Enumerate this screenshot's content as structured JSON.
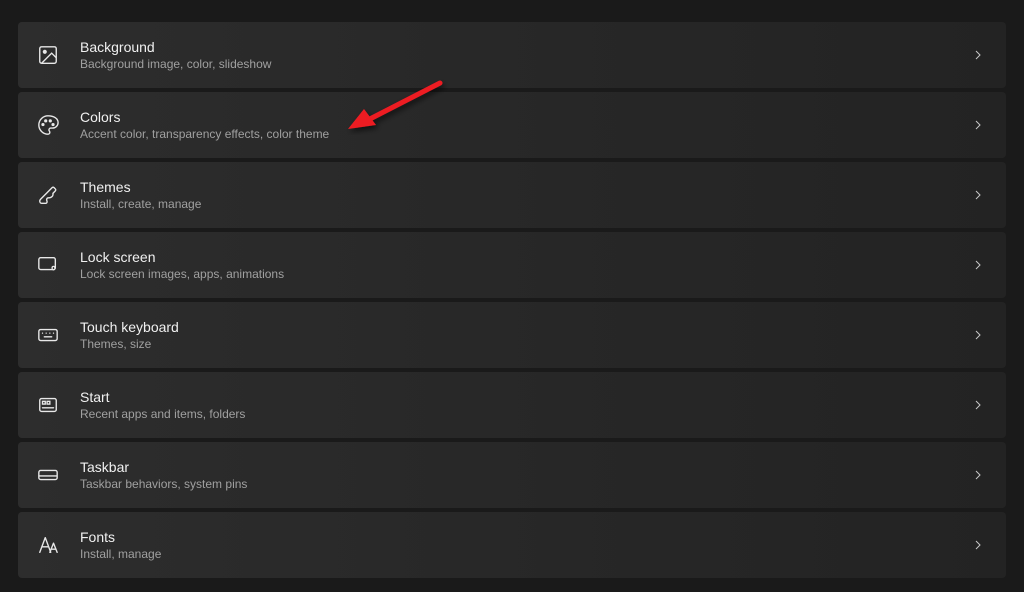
{
  "items": [
    {
      "id": "background",
      "title": "Background",
      "desc": "Background image, color, slideshow"
    },
    {
      "id": "colors",
      "title": "Colors",
      "desc": "Accent color, transparency effects, color theme"
    },
    {
      "id": "themes",
      "title": "Themes",
      "desc": "Install, create, manage"
    },
    {
      "id": "lock-screen",
      "title": "Lock screen",
      "desc": "Lock screen images, apps, animations"
    },
    {
      "id": "touch-keyboard",
      "title": "Touch keyboard",
      "desc": "Themes, size"
    },
    {
      "id": "start",
      "title": "Start",
      "desc": "Recent apps and items, folders"
    },
    {
      "id": "taskbar",
      "title": "Taskbar",
      "desc": "Taskbar behaviors, system pins"
    },
    {
      "id": "fonts",
      "title": "Fonts",
      "desc": "Install, manage"
    }
  ],
  "colors": {
    "arrow": "#ed1c24",
    "background": "#1a1a1a",
    "itemBg": "#2d2d2d",
    "textPrimary": "#f0f0f0",
    "textSecondary": "#a0a0a0"
  }
}
